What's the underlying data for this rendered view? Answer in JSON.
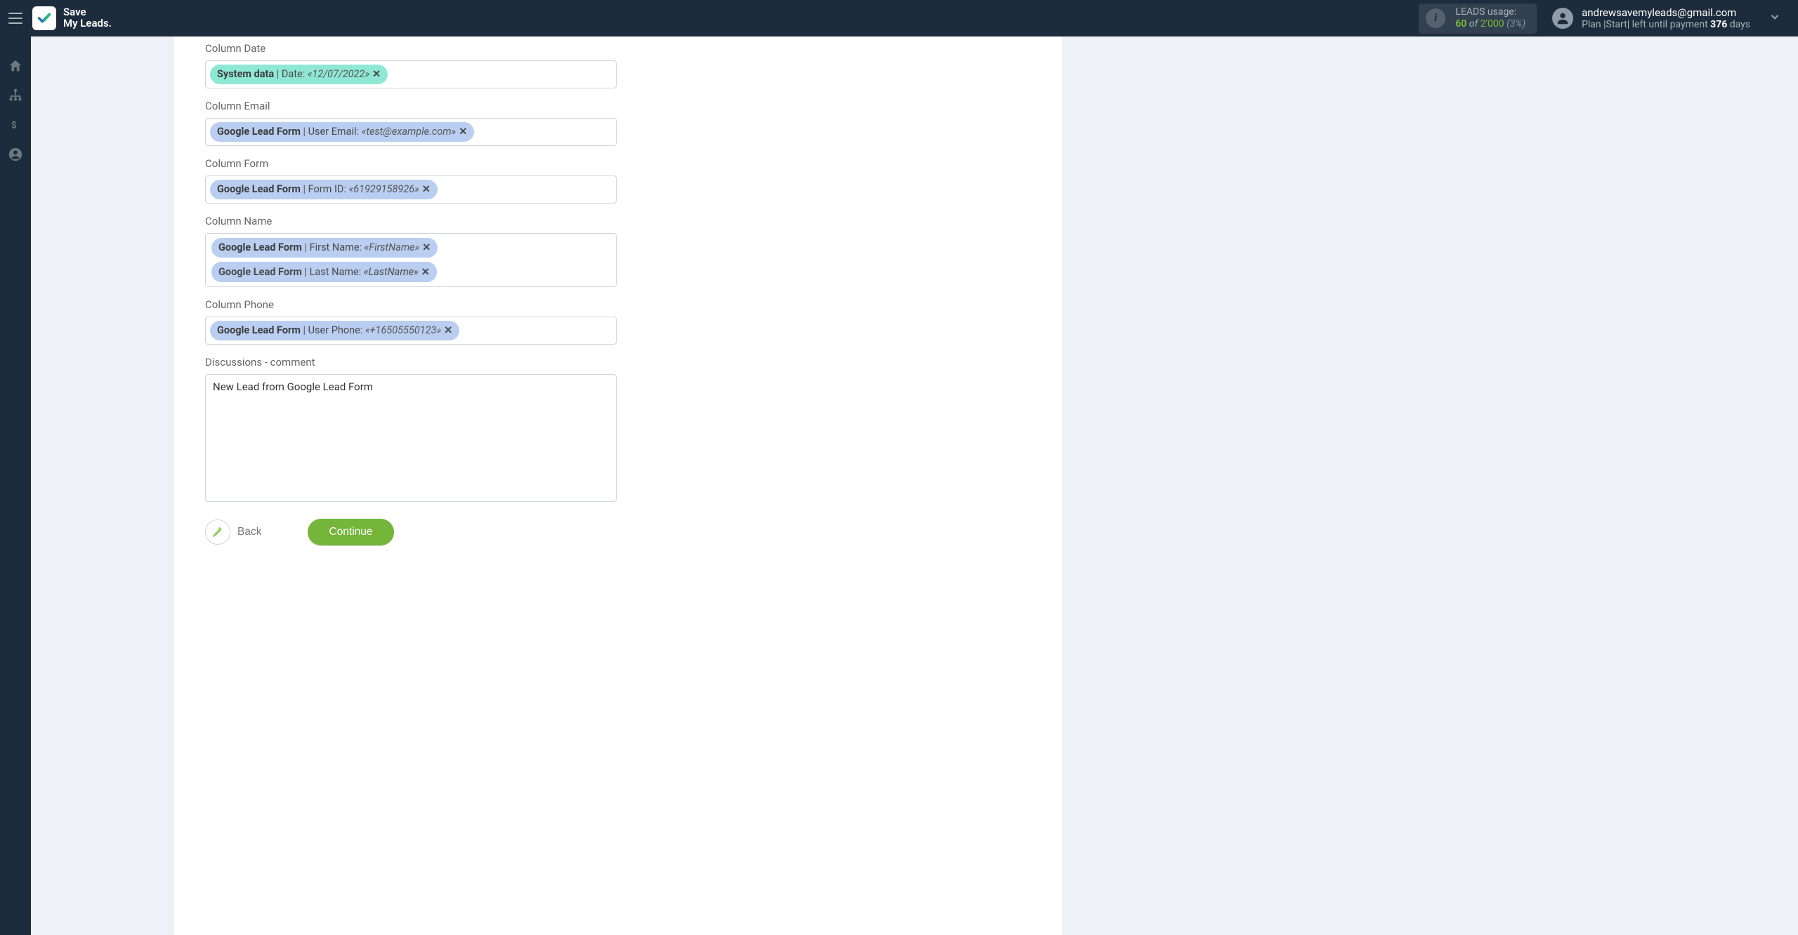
{
  "app": {
    "name_line1": "Save",
    "name_line2": "My Leads"
  },
  "usage": {
    "label": "LEADS usage:",
    "current": "60",
    "of_word": "of",
    "max": "2'000",
    "percent": "(3%)"
  },
  "account": {
    "email": "andrewsavemyleads@gmail.com",
    "plan_prefix": "Plan |Start| left until payment ",
    "days_value": "376",
    "days_suffix": " days"
  },
  "fields": {
    "date": {
      "label": "Column Date",
      "tokens": [
        {
          "kind": "sys",
          "source": "System data",
          "field": "Date",
          "value": "«12/07/2022»"
        }
      ]
    },
    "email": {
      "label": "Column Email",
      "tokens": [
        {
          "kind": "glf",
          "source": "Google Lead Form",
          "field": "User Email",
          "value": "«test@example.com»"
        }
      ]
    },
    "form": {
      "label": "Column Form",
      "tokens": [
        {
          "kind": "glf",
          "source": "Google Lead Form",
          "field": "Form ID",
          "value": "«61929158926»"
        }
      ]
    },
    "name": {
      "label": "Column Name",
      "tokens": [
        {
          "kind": "glf",
          "source": "Google Lead Form",
          "field": "First Name",
          "value": "«FirstName»"
        },
        {
          "kind": "glf",
          "source": "Google Lead Form",
          "field": "Last Name",
          "value": "«LastName»"
        }
      ]
    },
    "phone": {
      "label": "Column Phone",
      "tokens": [
        {
          "kind": "glf",
          "source": "Google Lead Form",
          "field": "User Phone",
          "value": "«+16505550123»"
        }
      ]
    },
    "comment": {
      "label": "Discussions - comment",
      "value": "New Lead from Google Lead Form"
    }
  },
  "actions": {
    "back": "Back",
    "continue": "Continue"
  }
}
